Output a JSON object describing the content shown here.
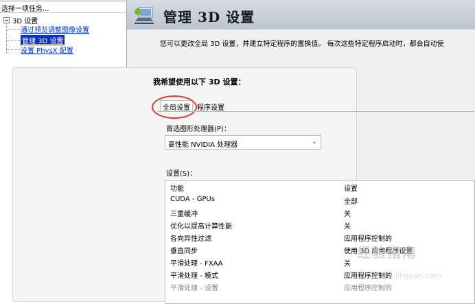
{
  "left_pane": {
    "title": "选择一项任务...",
    "tree": {
      "root": "3D 设置",
      "items": [
        {
          "label": "通过预览调整图像设置",
          "selected": false
        },
        {
          "label": "管理 3D 设置",
          "selected": true
        },
        {
          "label": "设置 PhysX 配置",
          "selected": false
        }
      ]
    }
  },
  "header": {
    "title": "管理 3D 设置",
    "icon": "nvidia-3d-settings-icon"
  },
  "description": "您可以更改全局 3D 设置，并建立特定程序的置换值。 每次这些特定程序启动时，都会自动使",
  "panel": {
    "heading": "我希望使用以下 3D 设置：",
    "tabs": [
      "全局设置",
      "程序设置"
    ],
    "active_tab": "全局设置",
    "highlight_color": "#e23a2c",
    "gpu_label": "首选图形处理器(P)：",
    "gpu_value": "高性能 NVIDIA 处理器",
    "settings_label": "设置(S)：",
    "table": {
      "headers": [
        "功能",
        "设置"
      ],
      "rows": [
        {
          "feature": "CUDA - GPUs",
          "value": "全部"
        },
        {
          "feature": "三重缓冲",
          "value": "关"
        },
        {
          "feature": "优化以提高计算性能",
          "value": "关"
        },
        {
          "feature": "各向异性过滤",
          "value": "应用程序控制的"
        },
        {
          "feature": "垂直同步",
          "value": "使用 3D 应用程序设置"
        },
        {
          "feature": "平滑处理 - FXAA",
          "value": "关"
        },
        {
          "feature": "平滑处理 - 模式",
          "value": "应用程序控制的"
        },
        {
          "feature": "平滑处理 - 设置",
          "value": "应用程序控制的",
          "disabled": true
        }
      ]
    }
  },
  "watermark": {
    "main": "经验指南",
    "sub": "jingyan.com"
  }
}
